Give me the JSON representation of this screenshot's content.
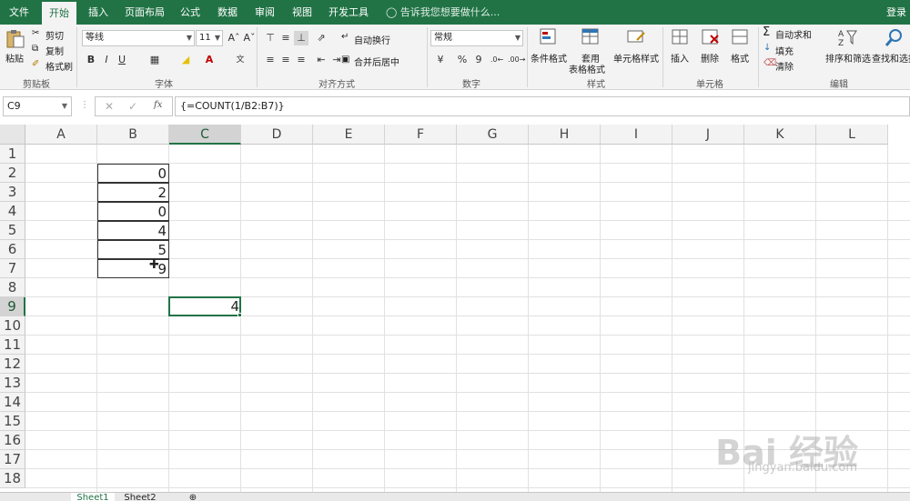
{
  "tabs": [
    "文件",
    "开始",
    "插入",
    "页面布局",
    "公式",
    "数据",
    "审阅",
    "视图",
    "开发工具"
  ],
  "tell_me": "告诉我您想要做什么...",
  "login": "登录",
  "ribbon": {
    "clipboard": {
      "paste": "粘贴",
      "cut": "剪切",
      "copy": "复制",
      "format_painter": "格式刷",
      "label": "剪贴板"
    },
    "font": {
      "name": "等线",
      "size": "11",
      "bold": "B",
      "italic": "I",
      "underline": "U",
      "label": "字体"
    },
    "alignment": {
      "wrap_text": "自动换行",
      "merge_center": "合并后居中",
      "label": "对齐方式"
    },
    "number": {
      "format": "常规",
      "percent": "%",
      "comma": "9",
      "label": "数字"
    },
    "styles": {
      "conditional": "条件格式",
      "table_line1": "套用",
      "table_line2": "表格格式",
      "cell_styles": "单元格样式",
      "label": "样式"
    },
    "cells": {
      "insert": "插入",
      "delete": "删除",
      "format": "格式",
      "label": "单元格"
    },
    "editing": {
      "autosum": "自动求和",
      "fill": "填充",
      "clear": "清除",
      "sort_filter": "排序和筛选",
      "find_select": "查找和选择",
      "label": "编辑"
    }
  },
  "name_box": "C9",
  "formula": "{=COUNT(1/B2:B7)}",
  "columns": [
    "A",
    "B",
    "C",
    "D",
    "E",
    "F",
    "G",
    "H",
    "I",
    "J",
    "K",
    "L"
  ],
  "rows": [
    "1",
    "2",
    "3",
    "4",
    "5",
    "6",
    "7",
    "8",
    "9",
    "10",
    "11",
    "12",
    "13",
    "14",
    "15",
    "16",
    "17",
    "18"
  ],
  "cells": {
    "B2": "0",
    "B3": "2",
    "B4": "0",
    "B5": "4",
    "B6": "5",
    "B7": "9",
    "C9": "4"
  },
  "sheets": [
    "Sheet1",
    "Sheet2"
  ],
  "watermark": {
    "brand": "Bai 经验",
    "url": "jingyan.baidu.com"
  },
  "colors": {
    "accent": "#217346"
  }
}
